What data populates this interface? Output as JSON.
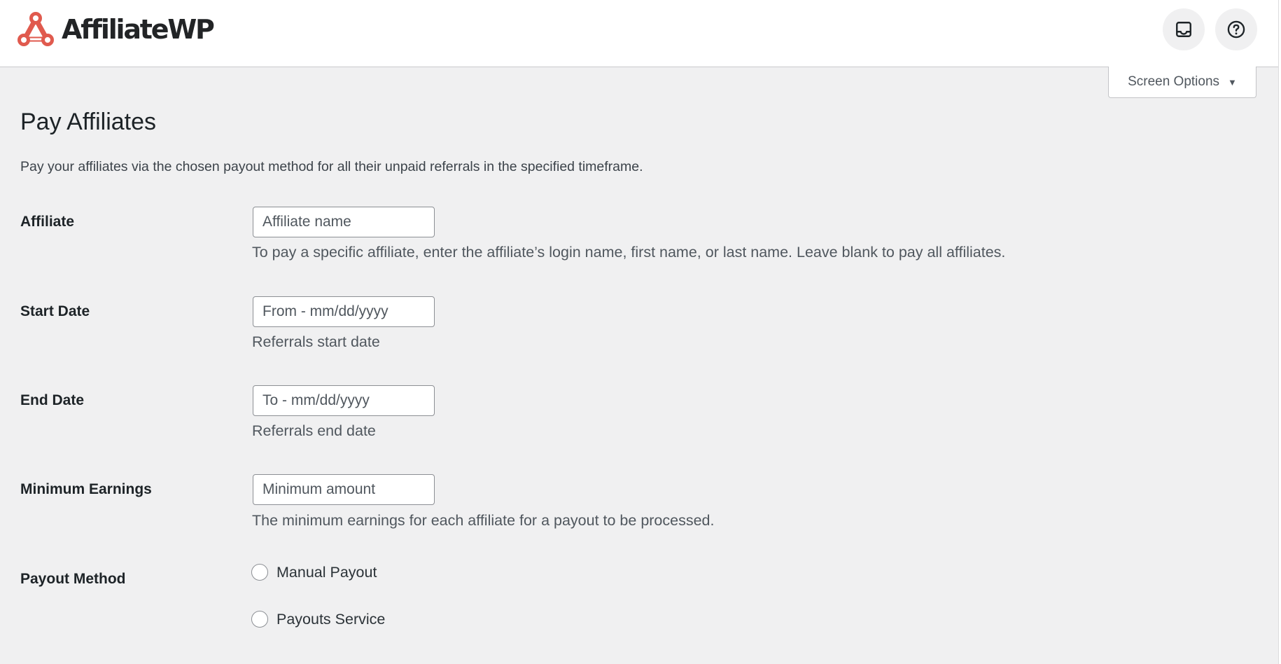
{
  "header": {
    "brand": "AffiliateWP",
    "brand_color": "#e05a4e",
    "icons": {
      "logo": "affiliatewp-logo-icon",
      "inbox": "inbox-icon",
      "help": "help-icon"
    },
    "screen_options_label": "Screen Options",
    "screen_options_caret": "▼"
  },
  "page": {
    "title": "Pay Affiliates",
    "description": "Pay your affiliates via the chosen payout method for all their unpaid referrals in the specified timeframe."
  },
  "form": {
    "affiliate": {
      "label": "Affiliate",
      "value": "",
      "placeholder": "Affiliate name",
      "description": "To pay a specific affiliate, enter the affiliate’s login name, first name, or last name. Leave blank to pay all affiliates."
    },
    "start_date": {
      "label": "Start Date",
      "value": "",
      "placeholder": "From - mm/dd/yyyy",
      "description": "Referrals start date"
    },
    "end_date": {
      "label": "End Date",
      "value": "",
      "placeholder": "To - mm/dd/yyyy",
      "description": "Referrals end date"
    },
    "minimum_earnings": {
      "label": "Minimum Earnings",
      "value": "",
      "placeholder": "Minimum amount",
      "description": "The minimum earnings for each affiliate for a payout to be processed."
    },
    "payout_method": {
      "label": "Payout Method",
      "options": [
        {
          "label": "Manual Payout",
          "checked": false
        },
        {
          "label": "Payouts Service",
          "checked": false
        }
      ]
    }
  }
}
